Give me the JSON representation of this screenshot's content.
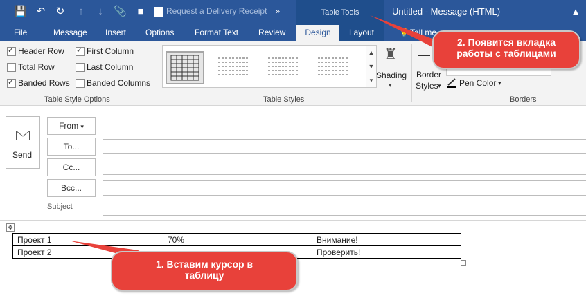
{
  "quick_access": {
    "receipt_label": "Request a Delivery Receipt"
  },
  "context_tab_group": "Table Tools",
  "window_title": "Untitled  -  Message (HTML)",
  "tabs": [
    "File",
    "Message",
    "Insert",
    "Options",
    "Format Text",
    "Review",
    "Design",
    "Layout",
    "Tell me"
  ],
  "style_options": {
    "items": [
      {
        "label": "Header Row",
        "checked": true
      },
      {
        "label": "First Column",
        "checked": true
      },
      {
        "label": "Total Row",
        "checked": false
      },
      {
        "label": "Last Column",
        "checked": false
      },
      {
        "label": "Banded Rows",
        "checked": true
      },
      {
        "label": "Banded Columns",
        "checked": false
      }
    ],
    "group_label": "Table Style Options"
  },
  "table_styles": {
    "group_label": "Table Styles",
    "shading_label": "Shading"
  },
  "borders": {
    "border_styles_line1": "Border",
    "border_styles_line2": "Styles",
    "pen_color_label": "Pen Color",
    "group_label": "Borders"
  },
  "compose": {
    "send_label": "Send",
    "from_label": "From",
    "to_label": "To...",
    "cc_label": "Cc...",
    "bcc_label": "Bcc...",
    "subject_label": "Subject"
  },
  "table": {
    "rows": [
      [
        "Проект 1",
        "70%",
        "Внимание!"
      ],
      [
        "Проект 2",
        "",
        "Проверить!"
      ]
    ]
  },
  "callouts": {
    "callout2_line1": "2. Появится вкладка",
    "callout2_line2": "работы с таблицами",
    "callout1_line1": "1. Вставим курсор в",
    "callout1_line2": "таблицу"
  },
  "colors": {
    "title_bar": "#2b579a",
    "callout": "#e8413a",
    "context_tab": "#1f4e8c"
  }
}
